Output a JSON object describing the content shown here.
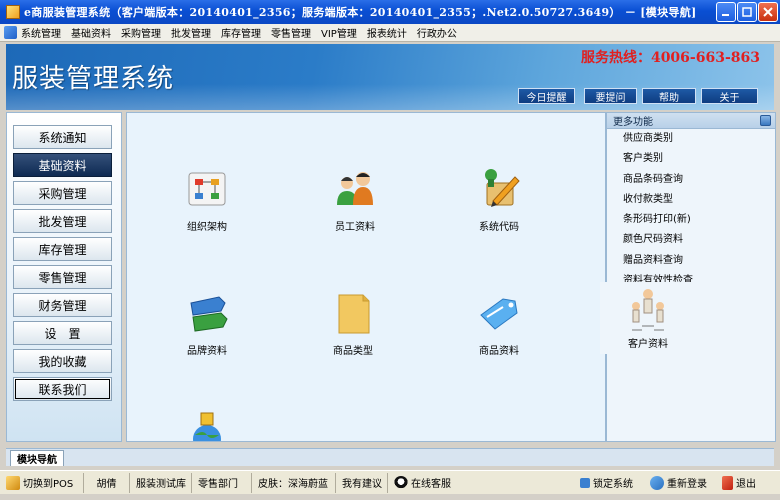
{
  "window": {
    "title": "e商服装管理系统（客户端版本：20140401_2356；服务端版本：20140401_2355；.Net2.0.50727.3649） － [模块导航]"
  },
  "menu": [
    "系统管理",
    "基础资料",
    "采购管理",
    "批发管理",
    "库存管理",
    "零售管理",
    "VIP管理",
    "报表统计",
    "行政办公"
  ],
  "banner": {
    "app_title": "服装管理系统",
    "hotline": "服务热线：4006-663-863",
    "buttons": [
      "今日提醒",
      "要提问",
      "帮助",
      "关于"
    ]
  },
  "nav": {
    "items": [
      "系统通知",
      "基础资料",
      "采购管理",
      "批发管理",
      "库存管理",
      "零售管理",
      "财务管理",
      "设　置",
      "我的收藏",
      "联系我们"
    ],
    "active": "基础资料"
  },
  "modules": [
    "组织架构",
    "员工资料",
    "系统代码",
    "品牌资料",
    "商品类型",
    "商品资料",
    "客户资料"
  ],
  "more": {
    "header": "更多功能",
    "items": [
      "供应商类别",
      "客户类别",
      "商品条码查询",
      "收付款类型",
      "条形码打印(新)",
      "颜色尺码资料",
      "赠品资料查询",
      "资料有效性检查"
    ]
  },
  "module_tab": "模块导航",
  "status": {
    "items": [
      "切换到POS",
      "胡倩",
      "服装测试库",
      "零售部门",
      "皮肤：深海蔚蓝",
      "我有建议",
      "在线客服",
      "锁定系统",
      "重新登录",
      "退出"
    ]
  },
  "colors": {
    "titlebar": "#0a4fd3",
    "banner": "#2b7cc8",
    "hotline": "#e02020",
    "nav_active": "#0e2a52",
    "content_bg": "#e8f3fc"
  },
  "icons": [
    "app-icon",
    "org-chart-icon",
    "staff-icon",
    "system-code-icon",
    "brand-tag-icon",
    "folder-icon",
    "product-tag-icon",
    "customer-icon",
    "pos-icon",
    "lock-icon",
    "relogin-icon",
    "exit-icon",
    "qq-icon"
  ]
}
